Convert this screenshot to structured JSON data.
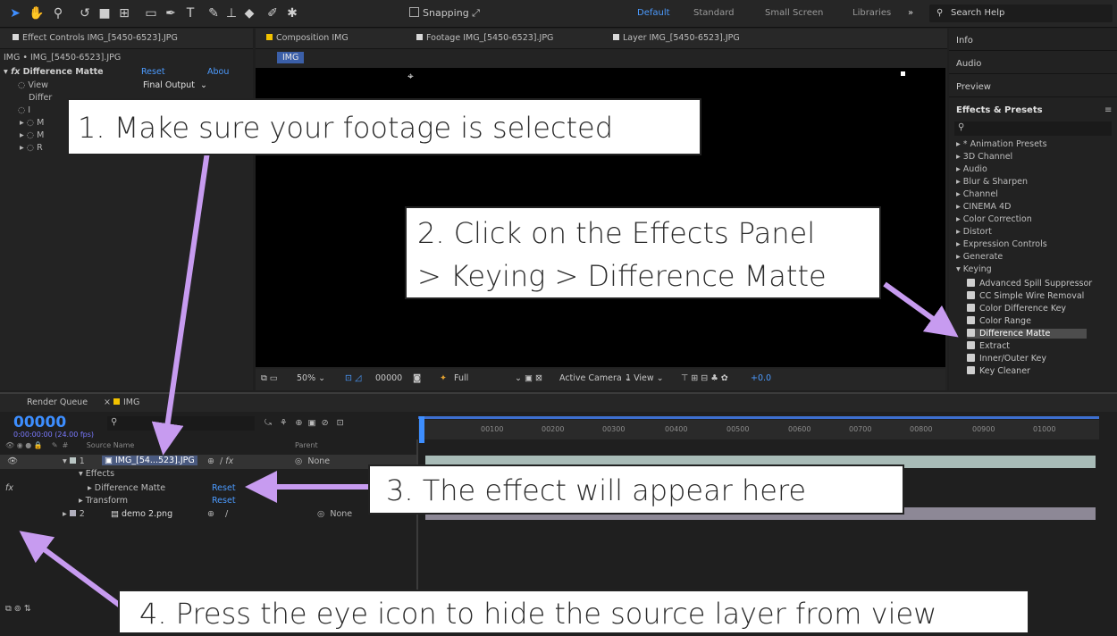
{
  "toolbar": {
    "snapping_label": "Snapping",
    "workspaces": [
      "Default",
      "Standard",
      "Small Screen",
      "Libraries"
    ],
    "search_placeholder": "Search Help"
  },
  "effect_controls": {
    "tab_label": "Effect Controls IMG_[5450-6523].JPG",
    "path": "IMG • IMG_[5450-6523].JPG",
    "effect_name": "Difference Matte",
    "reset": "Reset",
    "about": "Abou",
    "view_label": "View",
    "view_value": "Final Output",
    "diff_label": "Differ"
  },
  "composition": {
    "tab_label": "Composition IMG",
    "footage_tab": "Footage IMG_[5450-6523].JPG",
    "layer_tab": "Layer IMG_[5450-6523].JPG",
    "subtab": "IMG",
    "zoom": "50%",
    "timecode": "00000",
    "resolution": "Full",
    "camera": "Active Camera",
    "views": "1 View",
    "exposure": "+0.0"
  },
  "right_panel": {
    "info": "Info",
    "audio": "Audio",
    "preview": "Preview",
    "effects_presets": "Effects & Presets",
    "categories": [
      "* Animation Presets",
      "3D Channel",
      "Audio",
      "Blur & Sharpen",
      "Channel",
      "CINEMA 4D",
      "Color Correction",
      "Distort",
      "Expression Controls",
      "Generate",
      "Keying"
    ],
    "keying_items": [
      "Advanced Spill Suppressor",
      "CC Simple Wire Removal",
      "Color Difference Key",
      "Color Range",
      "Difference Matte",
      "Extract",
      "Inner/Outer Key",
      "Key Cleaner"
    ],
    "selected": "Difference Matte"
  },
  "timeline": {
    "render_queue": "Render Queue",
    "comp_tab": "IMG",
    "timecode": "00000",
    "fps": "0:00:00:00 (24.00 fps)",
    "ruler": [
      "00100",
      "00200",
      "00300",
      "00400",
      "00500",
      "00600",
      "00700",
      "00800",
      "00900",
      "01000"
    ],
    "source_name_header": "Source Name",
    "parent_header": "Parent",
    "layer1_num": "1",
    "layer1_name": "IMG_[54...523].JPG",
    "layer1_parent": "None",
    "effects": "Effects",
    "effect_row": "Difference Matte",
    "effect_reset": "Reset",
    "transform": "Transform",
    "transform_reset": "Reset",
    "layer2_num": "2",
    "layer2_name": "demo 2.png",
    "layer2_parent": "None"
  },
  "callouts": {
    "c1": "1. Make sure your footage is selected",
    "c2a": "2. Click on the Effects Panel",
    "c2b": "> Keying > Difference Matte",
    "c3": "3. The effect will appear here",
    "c4": "4. Press the eye icon to hide the source layer from view"
  },
  "colors": {
    "accent": "#3d8eff",
    "arrow": "#c79bf0"
  }
}
